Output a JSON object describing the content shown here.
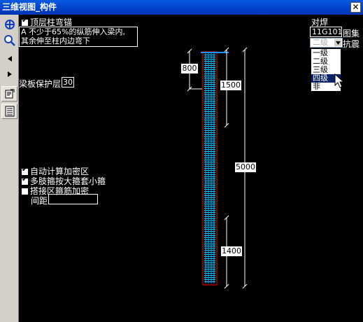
{
  "window": {
    "title": "三维视图_构件",
    "close_glyph": "✕"
  },
  "toolbar": {
    "icons": [
      "rotate-3d-icon",
      "zoom-icon",
      "arrow-left-icon",
      "arrow-right-icon",
      "edit-properties-icon",
      "table-list-icon"
    ]
  },
  "left_panel": {
    "top_anchor_checkbox": "顶层柱弯锚",
    "anchor_note_line1": "A 不少于65%的纵筋伸入梁内,",
    "anchor_note_line2": "其余伸至柱内边弯下",
    "cover_label": "梁板保护层",
    "cover_value": "30",
    "auto_calc": "自动计算加密区",
    "multi_leg": "多肢箍按大箍套小箍",
    "lap_zone": "搭接区箍筋加密",
    "spacing_label": "间距",
    "spacing_value": ""
  },
  "right_panel": {
    "splice_label": "对焊",
    "atlas_value": "11G101",
    "atlas_label": "图集",
    "grade_value": "二级",
    "seismic_label": "抗震",
    "grade_options": [
      "一级",
      "二级",
      "三级",
      "四级",
      "非"
    ],
    "grade_highlighted": "四级"
  },
  "dimensions": {
    "top_offset": "800",
    "top_dense": "1500",
    "total": "5000",
    "bottom_dense": "1400"
  },
  "colors": {
    "column_outline": "#ff0000",
    "stirrup": "#00e5ff",
    "dim_line": "#ffffff",
    "title_bar": "#0a5ae0"
  }
}
